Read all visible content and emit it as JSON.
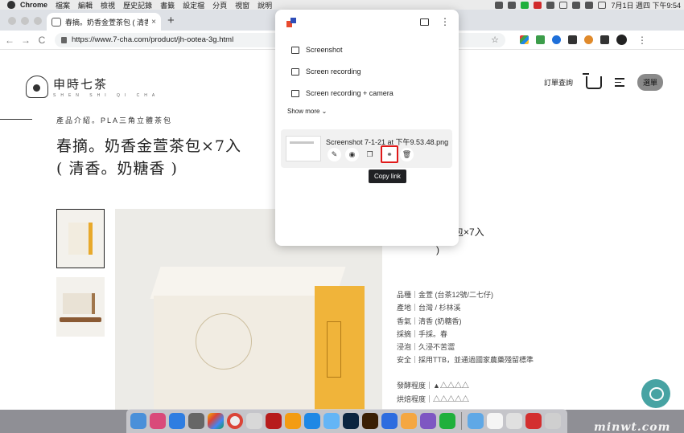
{
  "menubar": {
    "app_name": "Chrome",
    "menus": [
      "檔案",
      "編輯",
      "檢視",
      "歷史記錄",
      "書籤",
      "設定檔",
      "分頁",
      "視窗",
      "說明"
    ],
    "clock": "7月1日 週四 下午9:54"
  },
  "browser": {
    "tab_title": "春摘。奶香金萱茶包 ( 清香。奶",
    "tab_close": "×",
    "new_tab": "+",
    "back": "←",
    "forward": "→",
    "reload": "C",
    "url": "https://www.7-cha.com/product/jh-ootea-3g.html"
  },
  "site": {
    "logo_text": "申時七茶",
    "logo_sub": "SHEN SHI QI CHA",
    "order_lookup": "訂單查詢",
    "menu_label": "選單",
    "breadcrumb": "產品介紹。PLA三角立體茶包",
    "title_line1": "春摘。奶香金萱茶包×7入",
    "title_line2": "( 清香。奶糖香 )",
    "info_title": "萱茶包×7入",
    "info_sub": ")",
    "specs": [
      "品種｜金萱 (台茶12號/二七仔)",
      "產地｜台灣 / 杉林溪",
      "香氣｜清香 (奶糖香)",
      "採摘｜手採。春",
      "浸泡｜久浸不苦澀",
      "安全｜採用TTB，並通過國家農藥殘留標準"
    ],
    "ratings": [
      "發酵程度｜▲△△△△",
      "烘焙程度｜△△△△△"
    ]
  },
  "popup": {
    "items": [
      "Screenshot",
      "Screen recording",
      "Screen recording + camera"
    ],
    "show_more": "Show more ⌄",
    "capture_name": "Screenshot 7-1-21 at 下午9.53.48.png",
    "tooltip": "Copy link"
  },
  "watermark": "minwt.com",
  "colors": {
    "highlight": "#e01919",
    "chat": "#47a3a3",
    "tea_orange": "#f0b43a"
  }
}
